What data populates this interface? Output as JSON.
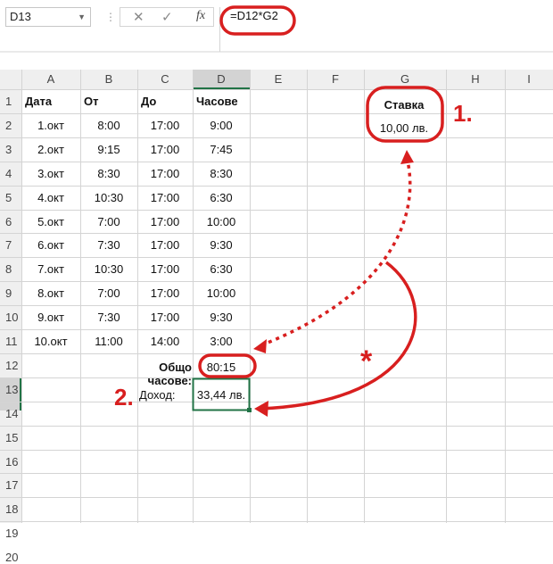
{
  "formula_bar": {
    "name_box": "D13",
    "cancel_icon": "✕",
    "enter_icon": "✓",
    "fx_label": "fx",
    "formula": "=D12*G2"
  },
  "columns": [
    "A",
    "B",
    "C",
    "D",
    "E",
    "F",
    "G",
    "H",
    "I"
  ],
  "rows": [
    "1",
    "2",
    "3",
    "4",
    "5",
    "6",
    "7",
    "8",
    "9",
    "10",
    "11",
    "12",
    "13",
    "14",
    "15",
    "16",
    "17",
    "18",
    "19",
    "20"
  ],
  "table": {
    "headers": [
      "Дата",
      "От",
      "До",
      "Часове"
    ],
    "data": [
      [
        "1.окт",
        "8:00",
        "17:00",
        "9:00"
      ],
      [
        "2.окт",
        "9:15",
        "17:00",
        "7:45"
      ],
      [
        "3.окт",
        "8:30",
        "17:00",
        "8:30"
      ],
      [
        "4.окт",
        "10:30",
        "17:00",
        "6:30"
      ],
      [
        "5.окт",
        "7:00",
        "17:00",
        "10:00"
      ],
      [
        "6.окт",
        "7:30",
        "17:00",
        "9:30"
      ],
      [
        "7.окт",
        "10:30",
        "17:00",
        "6:30"
      ],
      [
        "8.окт",
        "7:00",
        "17:00",
        "10:00"
      ],
      [
        "9.окт",
        "7:30",
        "17:00",
        "9:30"
      ],
      [
        "10.окт",
        "11:00",
        "14:00",
        "3:00"
      ]
    ]
  },
  "total": {
    "label": "Общо часове:",
    "value": "80:15"
  },
  "income": {
    "label": "Доход:",
    "value": "33,44 лв."
  },
  "rate": {
    "label": "Ставка",
    "value": "10,00 лв."
  },
  "annotations": {
    "one": "1.",
    "two": "2.",
    "star": "*"
  },
  "colors": {
    "accent_red": "#d81f1f",
    "grid": "#d4d4d4",
    "header_bg": "#efefef",
    "selection": "#217346"
  }
}
